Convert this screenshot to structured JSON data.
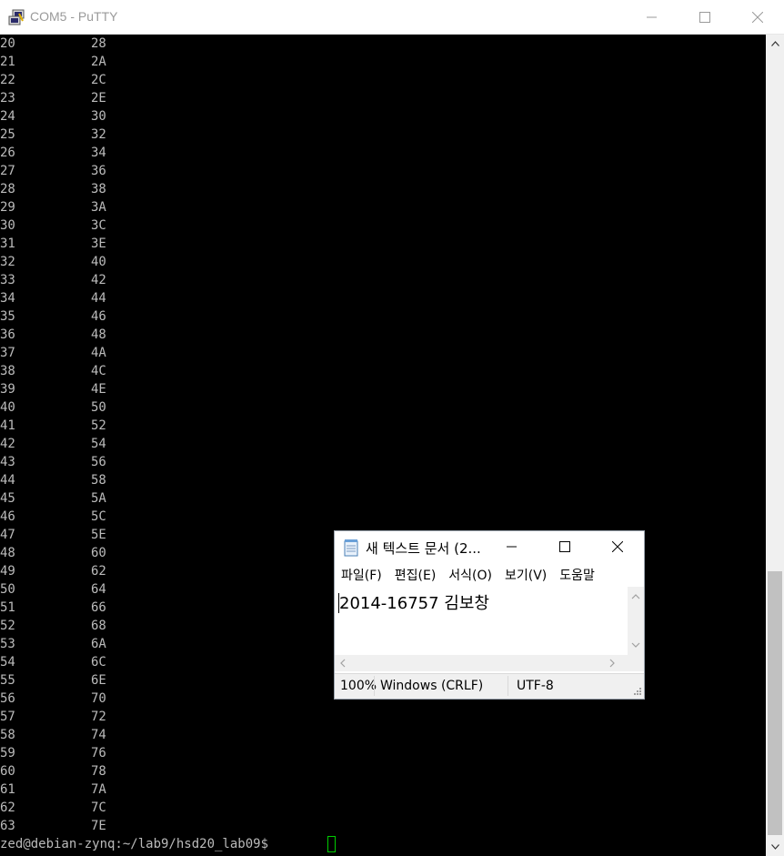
{
  "putty": {
    "title": "COM5 - PuTTY",
    "rows": [
      {
        "dec": "20",
        "hex": "28"
      },
      {
        "dec": "21",
        "hex": "2A"
      },
      {
        "dec": "22",
        "hex": "2C"
      },
      {
        "dec": "23",
        "hex": "2E"
      },
      {
        "dec": "24",
        "hex": "30"
      },
      {
        "dec": "25",
        "hex": "32"
      },
      {
        "dec": "26",
        "hex": "34"
      },
      {
        "dec": "27",
        "hex": "36"
      },
      {
        "dec": "28",
        "hex": "38"
      },
      {
        "dec": "29",
        "hex": "3A"
      },
      {
        "dec": "30",
        "hex": "3C"
      },
      {
        "dec": "31",
        "hex": "3E"
      },
      {
        "dec": "32",
        "hex": "40"
      },
      {
        "dec": "33",
        "hex": "42"
      },
      {
        "dec": "34",
        "hex": "44"
      },
      {
        "dec": "35",
        "hex": "46"
      },
      {
        "dec": "36",
        "hex": "48"
      },
      {
        "dec": "37",
        "hex": "4A"
      },
      {
        "dec": "38",
        "hex": "4C"
      },
      {
        "dec": "39",
        "hex": "4E"
      },
      {
        "dec": "40",
        "hex": "50"
      },
      {
        "dec": "41",
        "hex": "52"
      },
      {
        "dec": "42",
        "hex": "54"
      },
      {
        "dec": "43",
        "hex": "56"
      },
      {
        "dec": "44",
        "hex": "58"
      },
      {
        "dec": "45",
        "hex": "5A"
      },
      {
        "dec": "46",
        "hex": "5C"
      },
      {
        "dec": "47",
        "hex": "5E"
      },
      {
        "dec": "48",
        "hex": "60"
      },
      {
        "dec": "49",
        "hex": "62"
      },
      {
        "dec": "50",
        "hex": "64"
      },
      {
        "dec": "51",
        "hex": "66"
      },
      {
        "dec": "52",
        "hex": "68"
      },
      {
        "dec": "53",
        "hex": "6A"
      },
      {
        "dec": "54",
        "hex": "6C"
      },
      {
        "dec": "55",
        "hex": "6E"
      },
      {
        "dec": "56",
        "hex": "70"
      },
      {
        "dec": "57",
        "hex": "72"
      },
      {
        "dec": "58",
        "hex": "74"
      },
      {
        "dec": "59",
        "hex": "76"
      },
      {
        "dec": "60",
        "hex": "78"
      },
      {
        "dec": "61",
        "hex": "7A"
      },
      {
        "dec": "62",
        "hex": "7C"
      },
      {
        "dec": "63",
        "hex": "7E"
      }
    ],
    "prompt": "zed@debian-zynq:~/lab9/hsd20_lab09$ ",
    "colors": {
      "background": "#000000",
      "text": "#bbbbbb",
      "cursor": "#00cc00"
    }
  },
  "notepad": {
    "title": "새 텍스트 문서 (2...",
    "menu": [
      "파일(F)",
      "편집(E)",
      "서식(O)",
      "보기(V)",
      "도움말"
    ],
    "content": "2014-16757 김보창",
    "status": {
      "zoom": "100%",
      "line_ending": "Windows (CRLF)",
      "encoding": "UTF-8"
    }
  }
}
